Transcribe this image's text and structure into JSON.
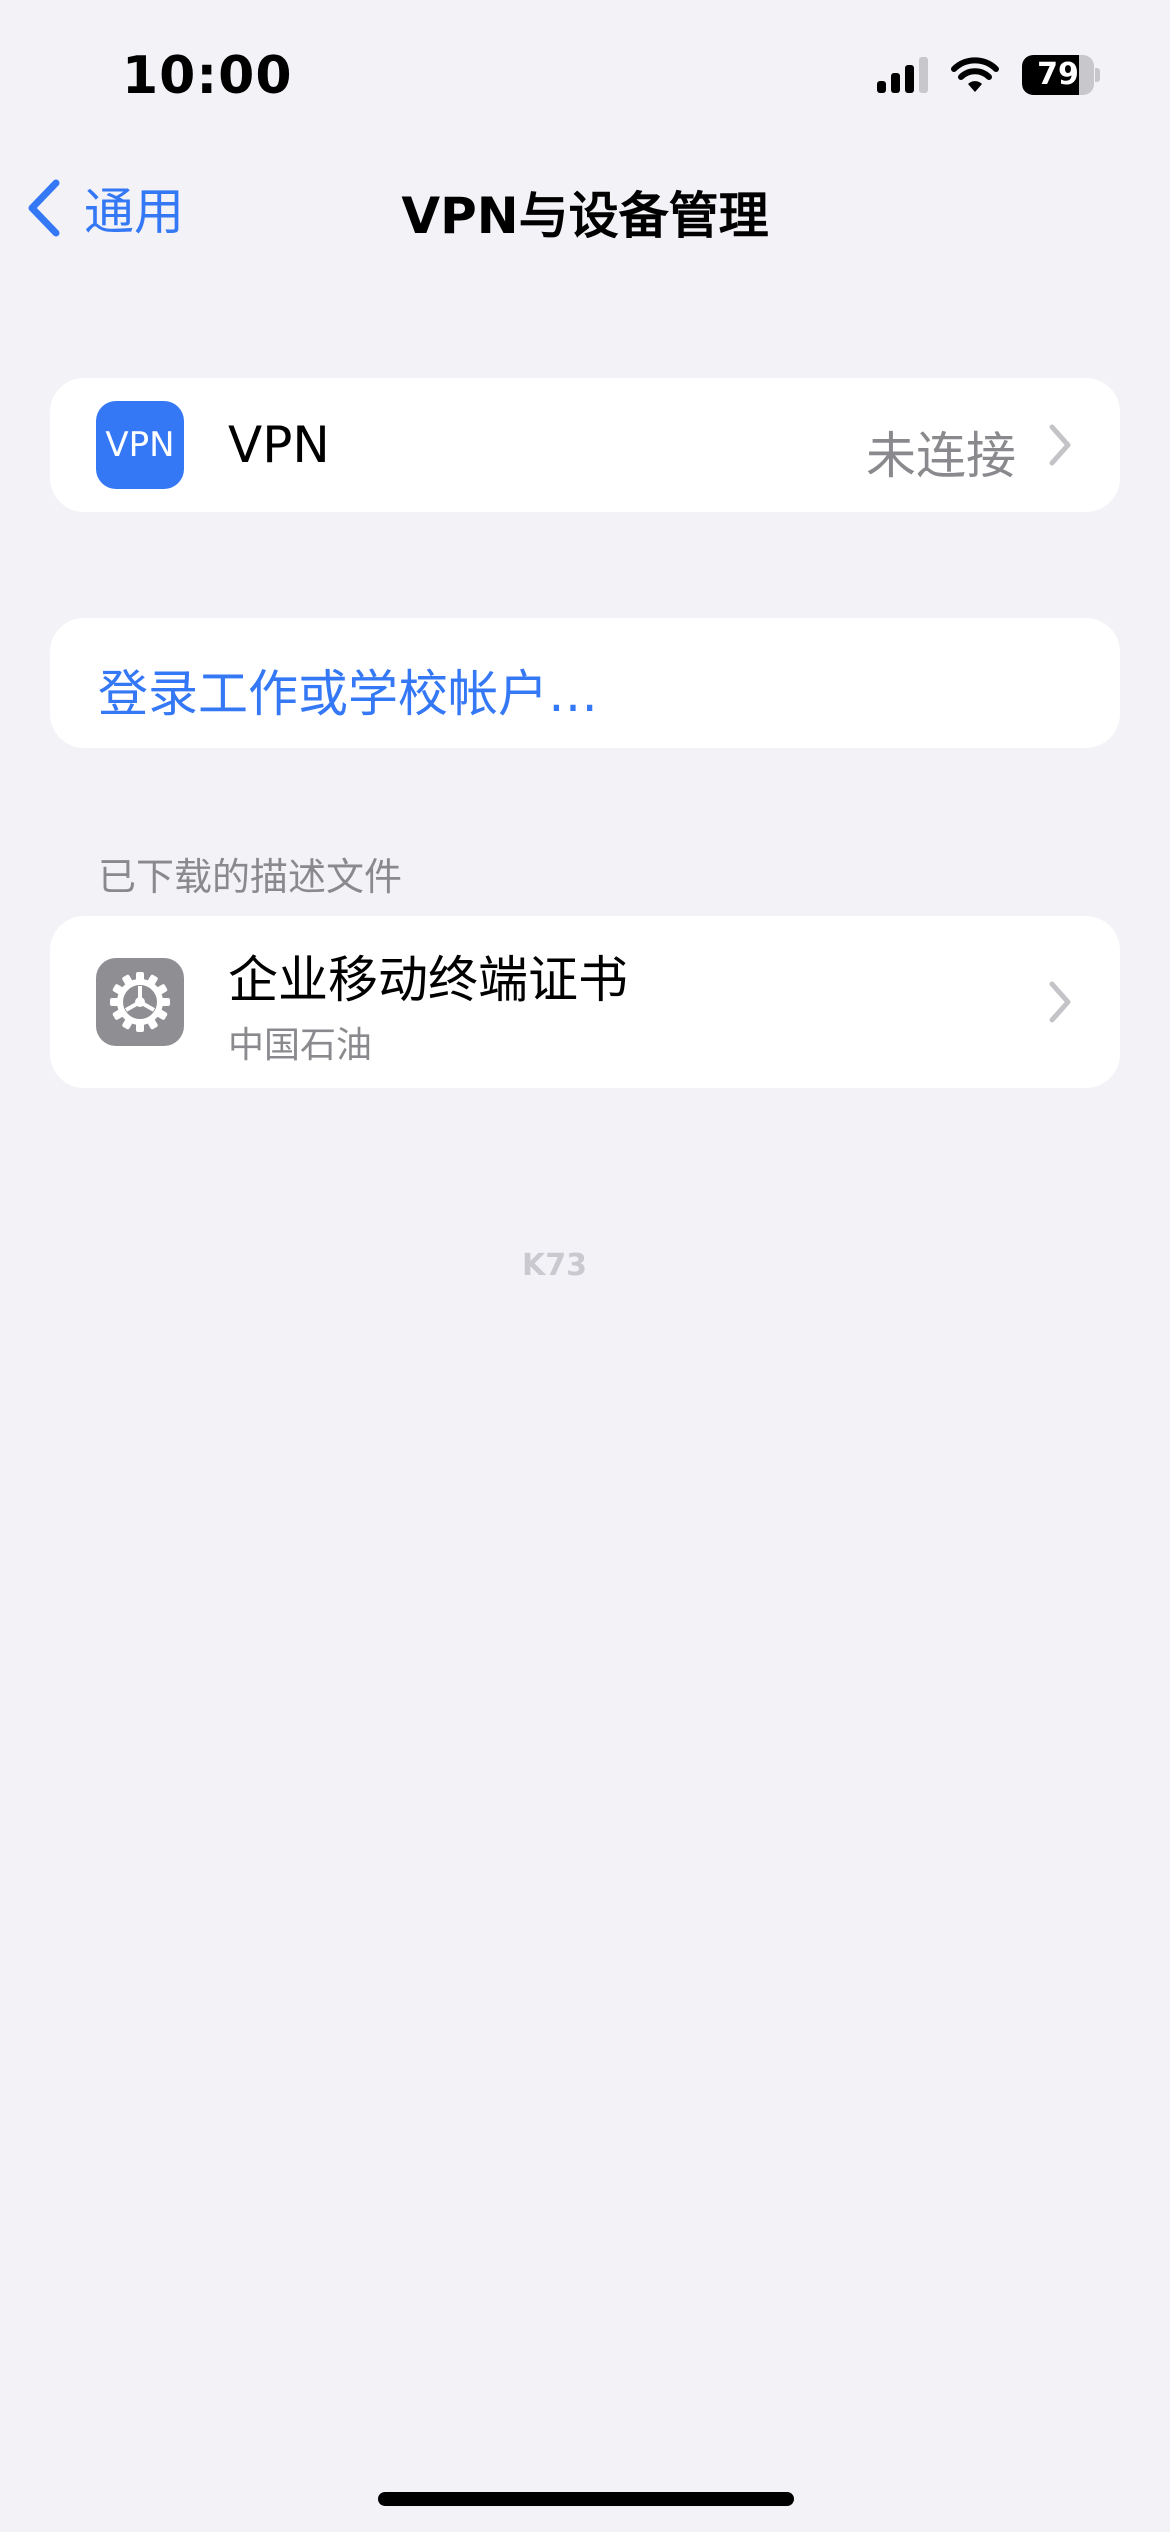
{
  "status_bar": {
    "time": "10:00",
    "battery": "79",
    "battery_level": 0.79
  },
  "nav": {
    "back_label": "通用",
    "title": "VPN与设备管理"
  },
  "vpn_row": {
    "icon_label": "VPN",
    "title": "VPN",
    "value": "未连接"
  },
  "account_link": {
    "label": "登录工作或学校帐户…"
  },
  "profiles_section": {
    "header": "已下载的描述文件",
    "items": [
      {
        "title": "企业移动终端证书",
        "subtitle": "中国石油"
      }
    ]
  },
  "watermark": "K73",
  "colors": {
    "accent": "#3478f6",
    "background": "#f2f2f7",
    "secondary_text": "#8a8a8e",
    "gear_bg": "#8e8e93"
  },
  "icons": [
    "signal-icon",
    "wifi-icon",
    "battery-icon",
    "back-chevron-icon",
    "chevron-right-icon",
    "gear-icon"
  ]
}
